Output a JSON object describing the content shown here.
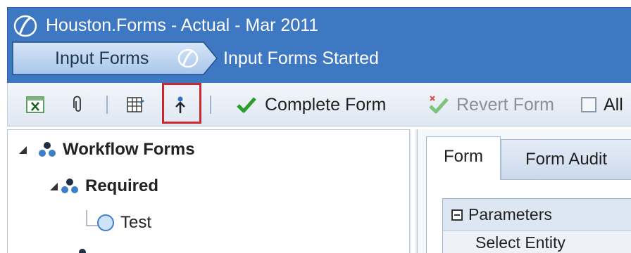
{
  "header": {
    "title": "Houston.Forms  -  Actual  -  Mar 2011",
    "breadcrumb_label": "Input Forms",
    "breadcrumb_status": "Input Forms Started"
  },
  "toolbar": {
    "complete_label": "Complete Form",
    "revert_label": "Revert Form",
    "all_label": "All",
    "highlight_color": "#c8292e"
  },
  "tree": {
    "root_label": "Workflow Forms",
    "group_label": "Required",
    "item_label": "Test"
  },
  "form_panel": {
    "tabs": [
      "Form",
      "Form Audit"
    ],
    "section_label": "Parameters",
    "row_label": "Select Entity"
  },
  "colors": {
    "header_bg": "#3f78c2",
    "check_green": "#2a9d2a",
    "node_blue": "#3a7fc8"
  }
}
